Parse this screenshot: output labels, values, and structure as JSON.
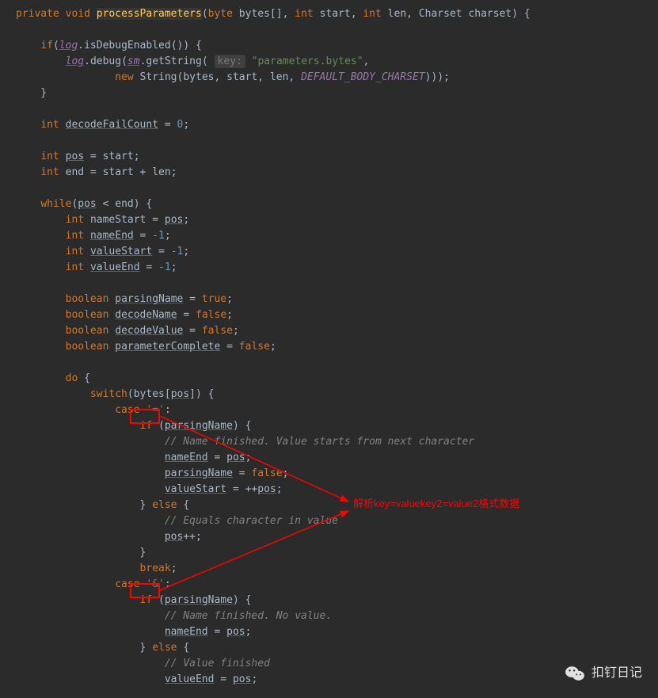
{
  "code": {
    "kw_private": "private",
    "kw_void": "void",
    "method_name": "processParameters",
    "kw_byte": "byte",
    "param_bytes": "bytes[]",
    "kw_int": "int",
    "param_start": "start",
    "param_len": "len",
    "type_charset": "Charset",
    "param_charset": "charset",
    "kw_if": "if",
    "field_log": "log",
    "method_isDebug": "isDebugEnabled",
    "method_debug": "debug",
    "field_sm": "sm",
    "method_getString": "getString",
    "hint_key": "key:",
    "str_params": "\"parameters.bytes\"",
    "kw_new": "new",
    "type_string": "String",
    "var_bytes": "bytes",
    "var_start": "start",
    "var_len": "len",
    "const_charset": "DEFAULT_BODY_CHARSET",
    "var_decodeFailCount": "decodeFailCount",
    "num_0": "0",
    "var_pos": "pos",
    "var_end": "end",
    "kw_while": "while",
    "var_nameStart": "nameStart",
    "var_nameEnd": "nameEnd",
    "num_neg1": "-1",
    "var_valueStart": "valueStart",
    "var_valueEnd": "valueEnd",
    "kw_boolean": "boolean",
    "var_parsingName": "parsingName",
    "kw_true": "true",
    "var_decodeName": "decodeName",
    "kw_false": "false",
    "var_decodeValue": "decodeValue",
    "var_parameterComplete": "parameterComplete",
    "kw_do": "do",
    "kw_switch": "switch",
    "kw_case": "case",
    "str_eq": "'='",
    "str_amp": "'&'",
    "comment_name_finished": "// Name finished. Value starts from next character",
    "comment_equals": "// Equals character in value",
    "kw_else": "else",
    "kw_break": "break",
    "comment_no_value": "// Name finished. No value.",
    "comment_value_finished": "// Value finished"
  },
  "annotation": {
    "text": "解析key=valuekey2=value2格式数据"
  },
  "watermark": {
    "text": "扣钉日记"
  }
}
